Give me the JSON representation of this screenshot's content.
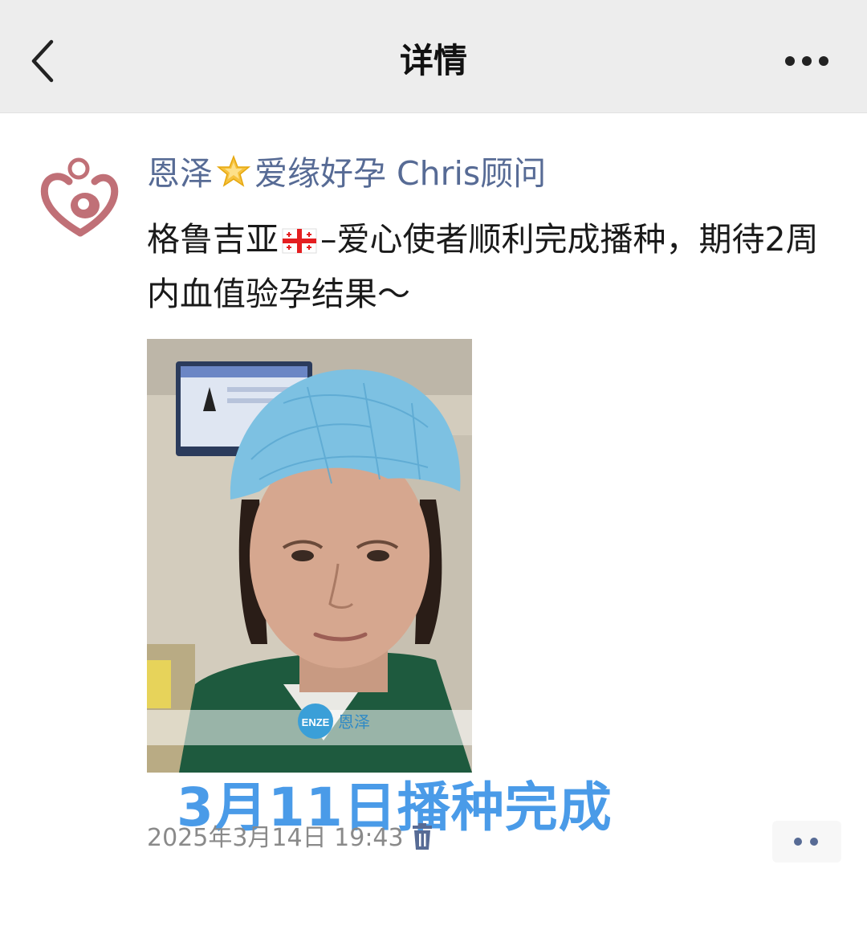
{
  "header": {
    "title": "详情",
    "back_icon": "chevron-left-icon",
    "more_icon": "more-horizontal-icon"
  },
  "post": {
    "author_name_part1": "恩泽",
    "author_name_part2": "爱缘好孕 Chris顾问",
    "author_emoji": "star-emoji",
    "content_part1": "格鲁吉亚",
    "content_part2": "–爱心使者顺利完成播种，期待2周内血值验孕结果～",
    "flag_emoji": "georgia-flag-emoji",
    "image": {
      "watermark_logo": "ENZE",
      "watermark_text": "恩泽",
      "caption": "3月11日播种完成"
    },
    "timestamp": "2025年3月14日 19:43",
    "delete_icon": "trash-icon",
    "action_icon": "comment-dots-icon"
  },
  "colors": {
    "author_link": "#576b95",
    "caption_blue": "#4a9be8",
    "topbar_bg": "#ededed",
    "timestamp_gray": "#8a8a8a"
  }
}
